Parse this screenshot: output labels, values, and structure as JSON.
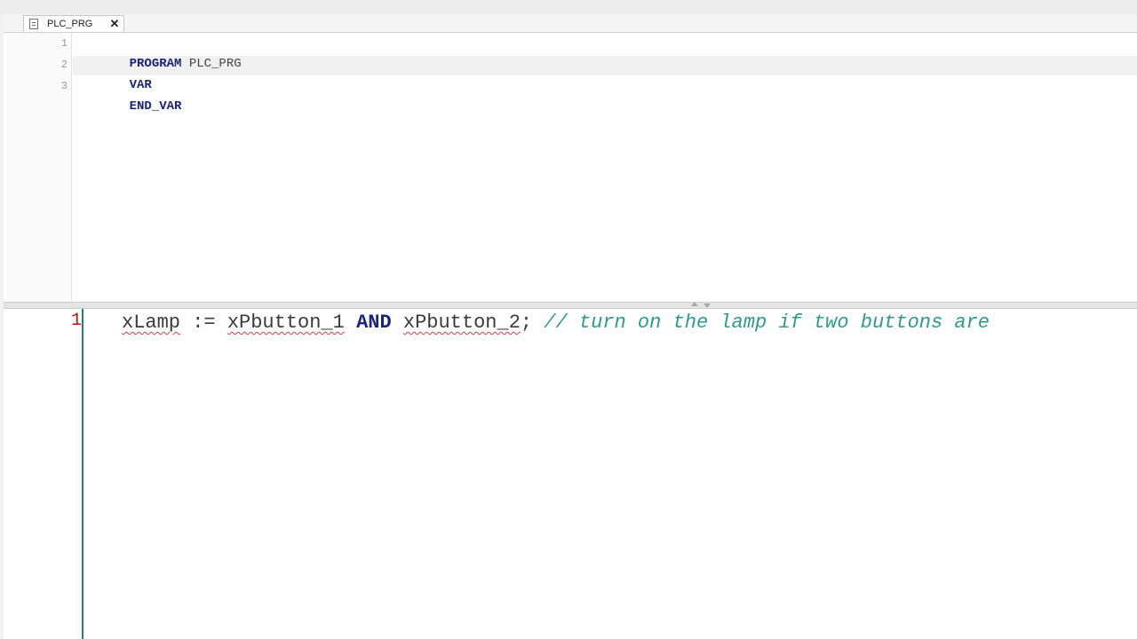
{
  "tab": {
    "label": "PLC_PRG",
    "icon": "document-icon",
    "close_glyph": "✕"
  },
  "declaration": {
    "line_numbers": [
      "1",
      "2",
      "3"
    ],
    "lines": [
      {
        "keyword": "PROGRAM",
        "rest": " PLC_PRG"
      },
      {
        "keyword": "VAR",
        "rest": ""
      },
      {
        "keyword": "END_VAR",
        "rest": ""
      }
    ]
  },
  "implementation": {
    "line_number": "1",
    "code": {
      "lhs": "xLamp",
      "assign": " := ",
      "arg1": "xPbutton_1",
      "op": "AND",
      "arg2": "xPbutton_2",
      "semicolon": ";",
      "comment": " // turn on the lamp if two buttons are"
    }
  },
  "colors": {
    "keyword": "#1a237e",
    "comment": "#2e9a8e",
    "error_underline": "#d04040",
    "line_number_error": "#b01818",
    "gutter_border": "#1f7f8a"
  }
}
